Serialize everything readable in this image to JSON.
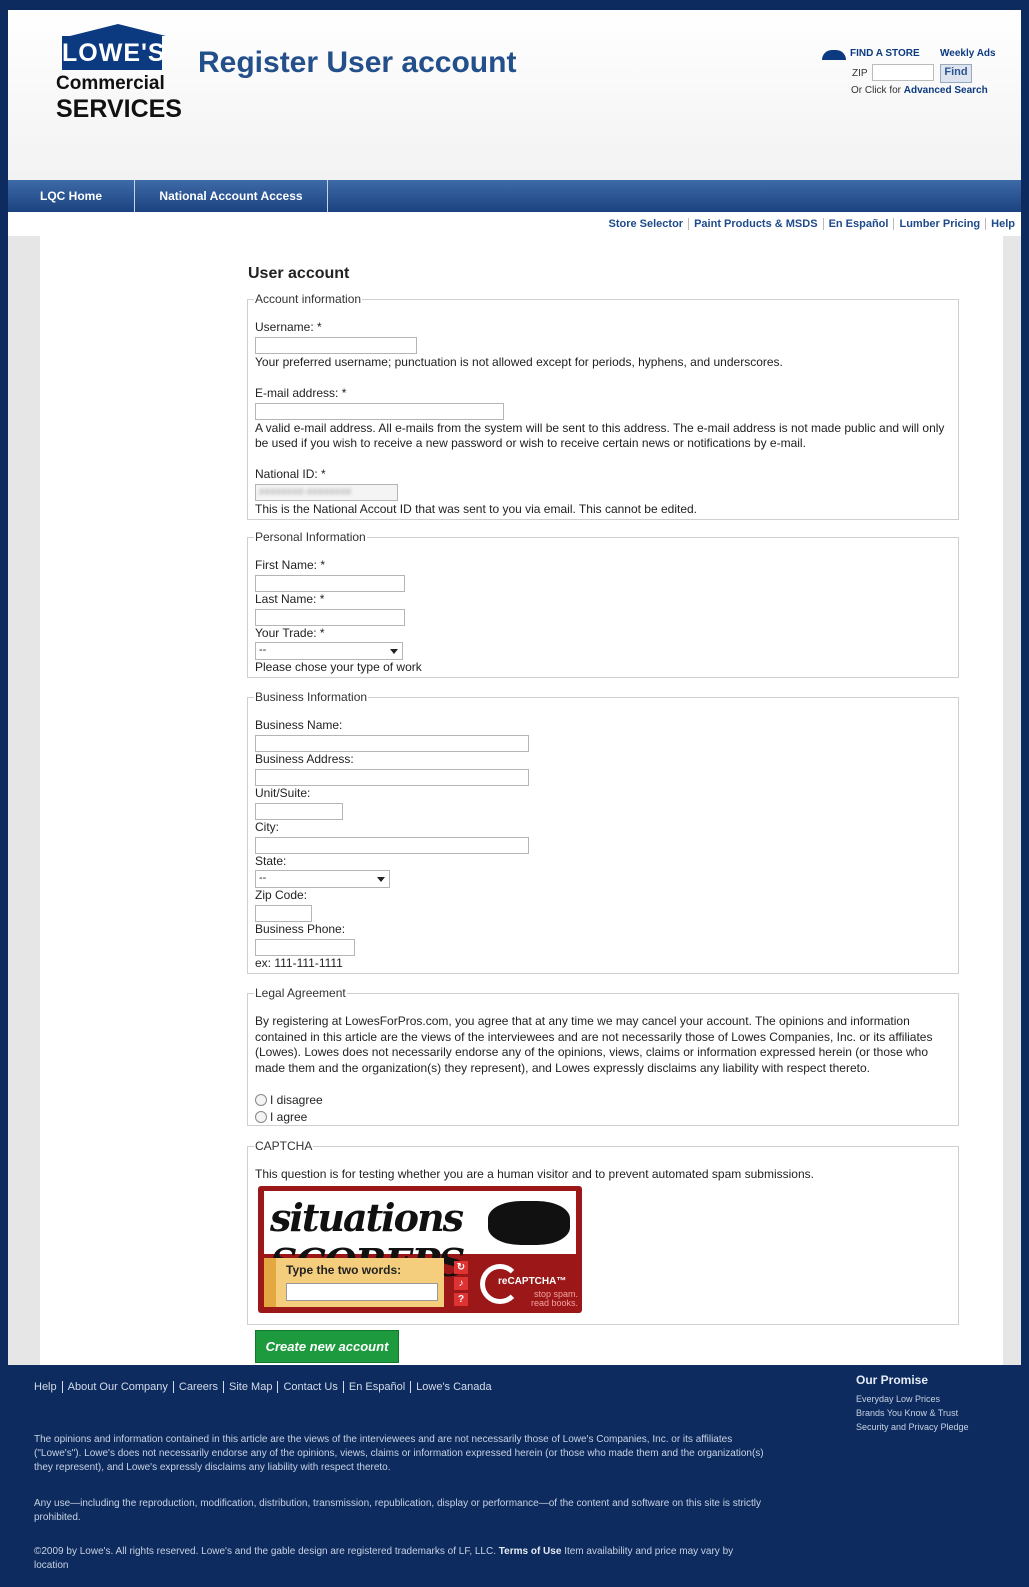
{
  "header": {
    "logo": {
      "line1": "LOWE'S",
      "line2": "Commercial",
      "line3": "SERVICES"
    },
    "page_title": "Register User account",
    "find_a_store": "FIND A STORE",
    "weekly_ads": "Weekly Ads",
    "zip_label": "ZIP",
    "find_button": "Find",
    "advanced_prefix": "Or Click for",
    "advanced_link": "Advanced Search"
  },
  "nav": {
    "tabs": [
      {
        "label": "LQC Home"
      },
      {
        "label": "National Account Access"
      }
    ]
  },
  "utility_links": [
    "Store Selector",
    "Paint Products & MSDS",
    "En Español",
    "Lumber Pricing",
    "Help"
  ],
  "form": {
    "section_title": "User account",
    "account": {
      "legend": "Account information",
      "username_label": "Username: *",
      "username_desc": "Your preferred username; punctuation is not allowed except for periods, hyphens, and underscores.",
      "email_label": "E-mail address: *",
      "email_desc": "A valid e-mail address. All e-mails from the system will be sent to this address. The e-mail address is not made public and will only be used if you wish to receive a new password or wish to receive certain news or notifications by e-mail.",
      "national_id_label": "National ID: *",
      "national_id_value": "########-########",
      "national_id_desc": "This is the National Accout ID that was sent to you via email. This cannot be edited."
    },
    "personal": {
      "legend": "Personal Information",
      "first_name_label": "First Name: *",
      "last_name_label": "Last Name: *",
      "trade_label": "Your Trade: *",
      "trade_value": "--",
      "trade_desc": "Please chose your type of work"
    },
    "business": {
      "legend": "Business Information",
      "name_label": "Business Name:",
      "address_label": "Business Address:",
      "unit_label": "Unit/Suite:",
      "city_label": "City:",
      "state_label": "State:",
      "state_value": "--",
      "zip_label": "Zip Code:",
      "phone_label": "Business Phone:",
      "phone_hint": "ex: 111-111-1111"
    },
    "legal": {
      "legend": "Legal Agreement",
      "text": "By registering at LowesForPros.com, you agree that at any time we may cancel your account. The opinions and information contained in this article are the views of the interviewees and are not necessarily those of Lowes Companies, Inc. or its affiliates (Lowes). Lowes does not necessarily endorse any of the opinions, views, claims or information expressed herein (or those who made them and the organization(s) they represent), and Lowes expressly disclaims any liability with respect thereto.",
      "disagree": "I disagree",
      "agree": "I agree"
    },
    "captcha": {
      "legend": "CAPTCHA",
      "desc": "This question is for testing whether you are a human visitor and to prevent automated spam submissions.",
      "words": "situations SCOREPS",
      "prompt": "Type the two words:",
      "brand": "reCAPTCHA™",
      "tagline": "stop spam. read books."
    },
    "submit_label": "Create new account"
  },
  "footer": {
    "links": [
      "Help",
      "About Our Company",
      "Careers",
      "Site Map",
      "Contact Us",
      "En Español",
      "Lowe's Canada"
    ],
    "promise_title": "Our Promise",
    "promise_items": [
      "Everyday Low Prices",
      "Brands You Know & Trust",
      "Security and Privacy Pledge"
    ],
    "disclaimer": "The opinions and information contained in this article are the views of the interviewees and are not necessarily those of Lowe's Companies, Inc. or its affiliates (\"Lowe's\"). Lowe's does not necessarily endorse any of the opinions, views, claims or information expressed herein (or those who made them and the organization(s) they represent), and Lowe's expressly disclaims any liability with respect thereto.",
    "use_notice": "Any use—including the reproduction, modification, distribution, transmission, republication, display or performance—of the content and software on this site is strictly prohibited.",
    "copyright": "©2009 by Lowe's. All rights reserved. Lowe's and the gable design are registered trademarks of LF, LLC.",
    "terms_link": "Terms of Use",
    "availability": "Item availability and price may vary by location"
  },
  "colors": {
    "brand_blue": "#0b3a80",
    "nav_blue": "#1a427f",
    "footer_bg": "#0d2b5e",
    "submit_green": "#1d9a3d",
    "captcha_red": "#9c1818"
  }
}
